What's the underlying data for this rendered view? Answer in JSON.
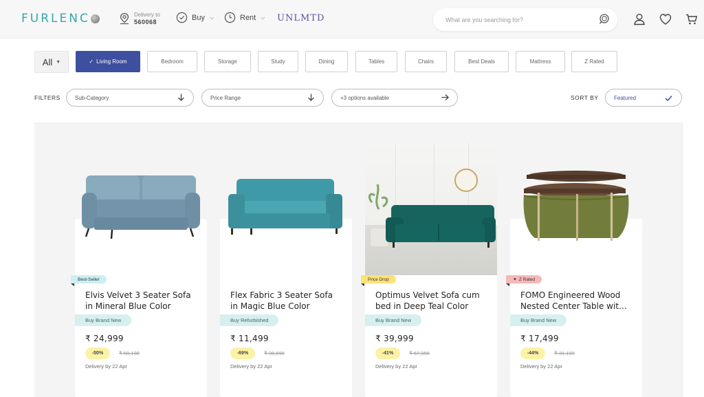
{
  "header": {
    "logo": "FURLENC",
    "delivery_label": "Delivery to",
    "delivery_pincode": "560068",
    "nav": [
      {
        "label": "Buy",
        "icon": "check-circle-icon"
      },
      {
        "label": "Rent",
        "icon": "clock-icon"
      }
    ],
    "unlmtd": "UNLMTD",
    "search_placeholder": "What are you searching for?",
    "icons": [
      "search-icon",
      "user-icon",
      "heart-icon",
      "cart-icon"
    ]
  },
  "categories": {
    "all_label": "All",
    "tabs": [
      {
        "label": "Living Room",
        "active": true
      },
      {
        "label": "Bedroom"
      },
      {
        "label": "Storage"
      },
      {
        "label": "Study"
      },
      {
        "label": "Dining"
      },
      {
        "label": "Tables"
      },
      {
        "label": "Chairs"
      },
      {
        "label": "Best Deals"
      },
      {
        "label": "Mattress"
      },
      {
        "label": "Z Rated"
      }
    ]
  },
  "filters": {
    "label": "FILTERS",
    "items": [
      "Sub-Category",
      "Price Range",
      "+3 options available"
    ],
    "sort_label": "SORT BY",
    "sort_value": "Featured"
  },
  "products": [
    {
      "badge": "Best-Seller",
      "badge_color": "#cdeef2",
      "name_line1": "Elvis Velvet 3 Seater Sofa",
      "name_line2": "in Mineral Blue Color",
      "condition": "Buy Brand New",
      "price": "₹ 24,999",
      "discount": "-50%",
      "mrp": "₹ 50,138",
      "delivery": "Delivery by 22 Apr"
    },
    {
      "badge": "",
      "badge_color": "",
      "name_line1": "Flex Fabric 3 Seater Sofa",
      "name_line2": "in Magic Blue Color",
      "condition": "Buy Refurbished",
      "price": "₹ 11,499",
      "discount": "-69%",
      "mrp": "₹ 36,690",
      "delivery": "Delivery by 22 Apr"
    },
    {
      "badge": "Price Drop",
      "badge_color": "#fbe27a",
      "name_line1": "Optimus Velvet Sofa cum",
      "name_line2": "bed in Deep Teal Color",
      "condition": "Buy Brand New",
      "price": "₹ 39,999",
      "discount": "-41%",
      "mrp": "₹ 67,356",
      "delivery": "Delivery by 22 Apr"
    },
    {
      "badge": "Z Rated",
      "badge_color": "#f4b9b9",
      "name_line1": "FOMO Engineered Wood",
      "name_line2": "Nested Center Table wit…",
      "condition": "Buy Brand New",
      "price": "₹ 17,499",
      "discount": "-44%",
      "mrp": "₹ 31,199",
      "delivery": "Delivery by 22 Apr"
    }
  ]
}
